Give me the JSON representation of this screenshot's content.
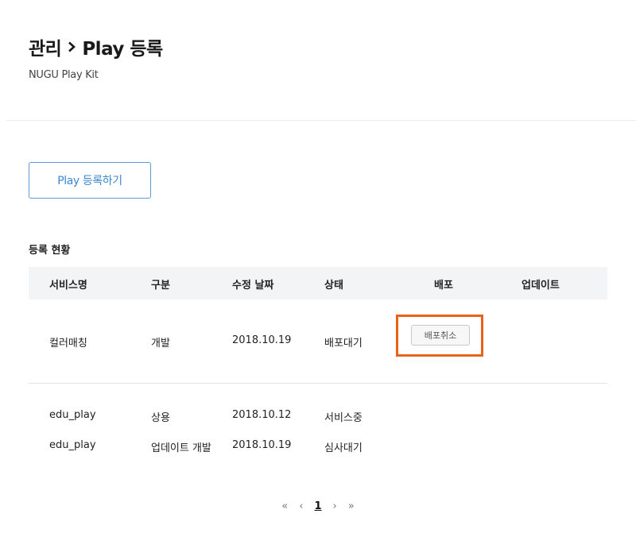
{
  "header": {
    "title_prefix": "관리",
    "title_suffix": "Play 등록",
    "subtitle": "NUGU Play Kit"
  },
  "actions": {
    "register_label": "Play 등록하기"
  },
  "section": {
    "title": "등록 현황"
  },
  "table": {
    "columns": [
      "서비스명",
      "구분",
      "수정 날짜",
      "상태",
      "배포",
      "업데이트"
    ],
    "rows": [
      {
        "name": "컬러매칭",
        "type": "개발",
        "date": "2018.10.19",
        "state": "배포대기",
        "deploy_label": "배포취소"
      },
      {
        "name": "edu_play",
        "type": "상용",
        "date": "2018.10.12",
        "state": "서비스중"
      },
      {
        "name": "edu_play",
        "type": "업데이트 개발",
        "date": "2018.10.19",
        "state": "심사대기"
      }
    ]
  },
  "pagination": {
    "first": "«",
    "prev": "‹",
    "current": "1",
    "next": "›",
    "last": "»"
  },
  "colors": {
    "accent": "#3d87cf",
    "highlight": "#e8621a",
    "header_bg": "#f3f4f6"
  }
}
